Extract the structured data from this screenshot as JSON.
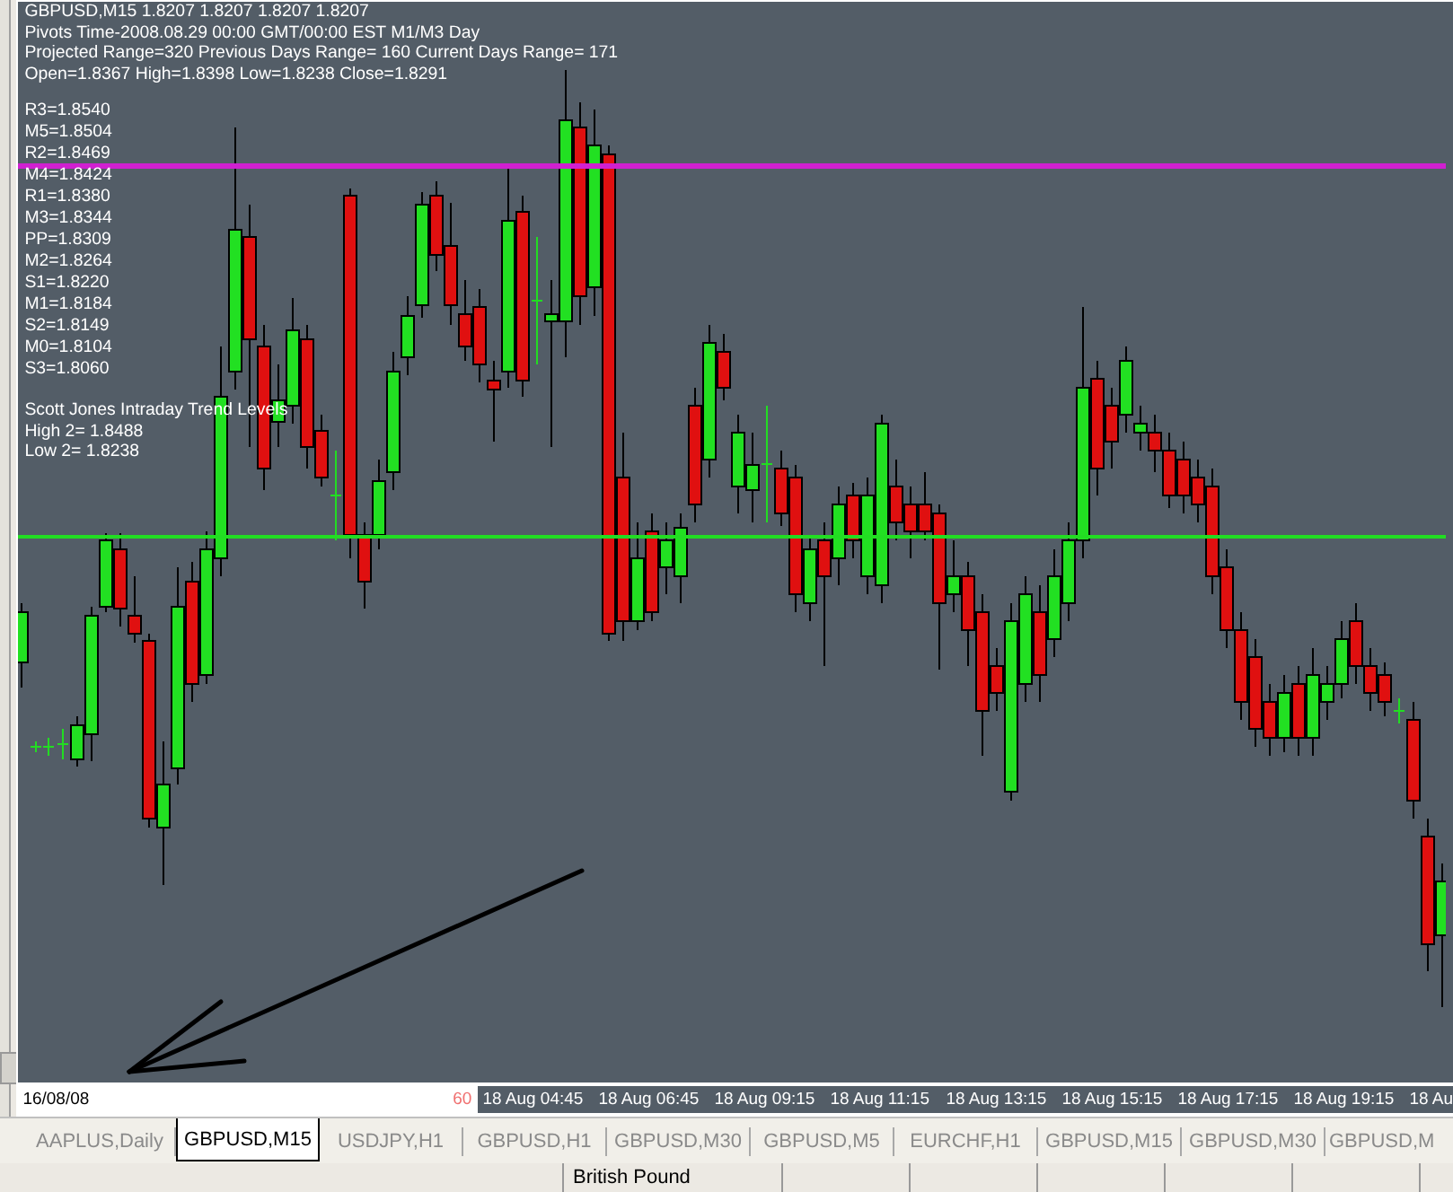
{
  "chart": {
    "header": [
      "GBPUSD,M15  1.8207 1.8207 1.8207 1.8207",
      "Pivots Time-2008.08.29 00:00 GMT/00:00 EST M1/M3 Day",
      "Projected Range=320 Previous Days Range= 160 Current Days Range= 171",
      "Open=1.8367 High=1.8398 Low=1.8238 Close=1.8291"
    ],
    "pivot_levels": [
      "R3=1.8540",
      "M5=1.8504",
      "R2=1.8469",
      "M4=1.8424",
      "R1=1.8380",
      "M3=1.8344",
      "PP=1.8309",
      "M2=1.8264",
      "S1=1.8220",
      "M1=1.8184",
      "S2=1.8149",
      "M0=1.8104",
      "S3=1.8060"
    ],
    "trend_title": "Scott Jones Intraday Trend Levels",
    "trend_levels": [
      "High 2= 1.8488",
      "Low 2= 1.8238"
    ],
    "time_axis": {
      "date": "16/08/08",
      "marker": "60",
      "labels": [
        "18 Aug 04:45",
        "18 Aug 06:45",
        "18 Aug 09:15",
        "18 Aug 11:15",
        "18 Aug 13:15",
        "18 Aug 15:15",
        "18 Aug 17:15",
        "18 Aug 19:15",
        "18 Au"
      ]
    }
  },
  "tabs": [
    {
      "label": "AAPLUS,Daily",
      "selected": false
    },
    {
      "label": "GBPUSD,M15",
      "selected": true
    },
    {
      "label": "USDJPY,H1",
      "selected": false
    },
    {
      "label": "GBPUSD,H1",
      "selected": false
    },
    {
      "label": "GBPUSD,M30",
      "selected": false
    },
    {
      "label": "GBPUSD,M5",
      "selected": false
    },
    {
      "label": "EURCHF,H1",
      "selected": false
    },
    {
      "label": "GBPUSD,M15",
      "selected": false
    },
    {
      "label": "GBPUSD,M30",
      "selected": false
    },
    {
      "label": "GBPUSD,M",
      "selected": false
    }
  ],
  "status_bar": {
    "panes": [
      "British Pound"
    ]
  }
}
